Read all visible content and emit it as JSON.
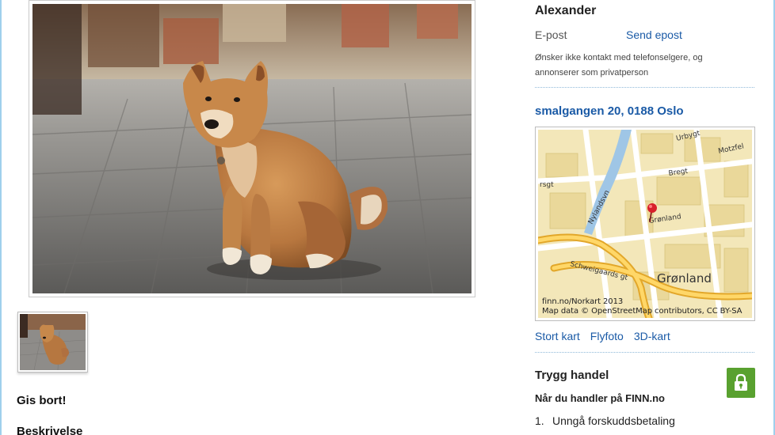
{
  "listing": {
    "title": "Gis bort!",
    "description_heading": "Beskrivelse",
    "photo_alt": "shiba-inu-puppy-photo"
  },
  "seller": {
    "name": "Alexander",
    "email_label": "E-post",
    "email_link": "Send epost",
    "notice": "Ønsker ikke kontakt med telefonselgere, og annonserer som privatperson"
  },
  "location": {
    "address": "smalgangen 20, 0188 Oslo",
    "map_credit_1": "finn.no/Norkart 2013",
    "map_credit_2": "Map data © OpenStreetMap contributors, CC BY-SA",
    "map_place": "Grønland",
    "streets": [
      "Nylandsvn",
      "Schweigaards gt",
      "Bregt",
      "Motzfel",
      "Grønland",
      "rsgt",
      "Urbygt"
    ],
    "links": [
      "Stort kart",
      "Flyfoto",
      "3D-kart"
    ]
  },
  "safe_trade": {
    "title": "Trygg handel",
    "subtitle": "Når du handler på FINN.no",
    "items": [
      {
        "num": "1.",
        "text": "Unngå forskuddsbetaling"
      }
    ]
  },
  "colors": {
    "link": "#1a5aa6",
    "safe_badge": "#59a12f",
    "page_edge": "#9fd0ec",
    "map_pin": "#d8202a"
  },
  "icons": {
    "safe_badge": "lock-icon",
    "map_pin": "map-pin-icon"
  }
}
